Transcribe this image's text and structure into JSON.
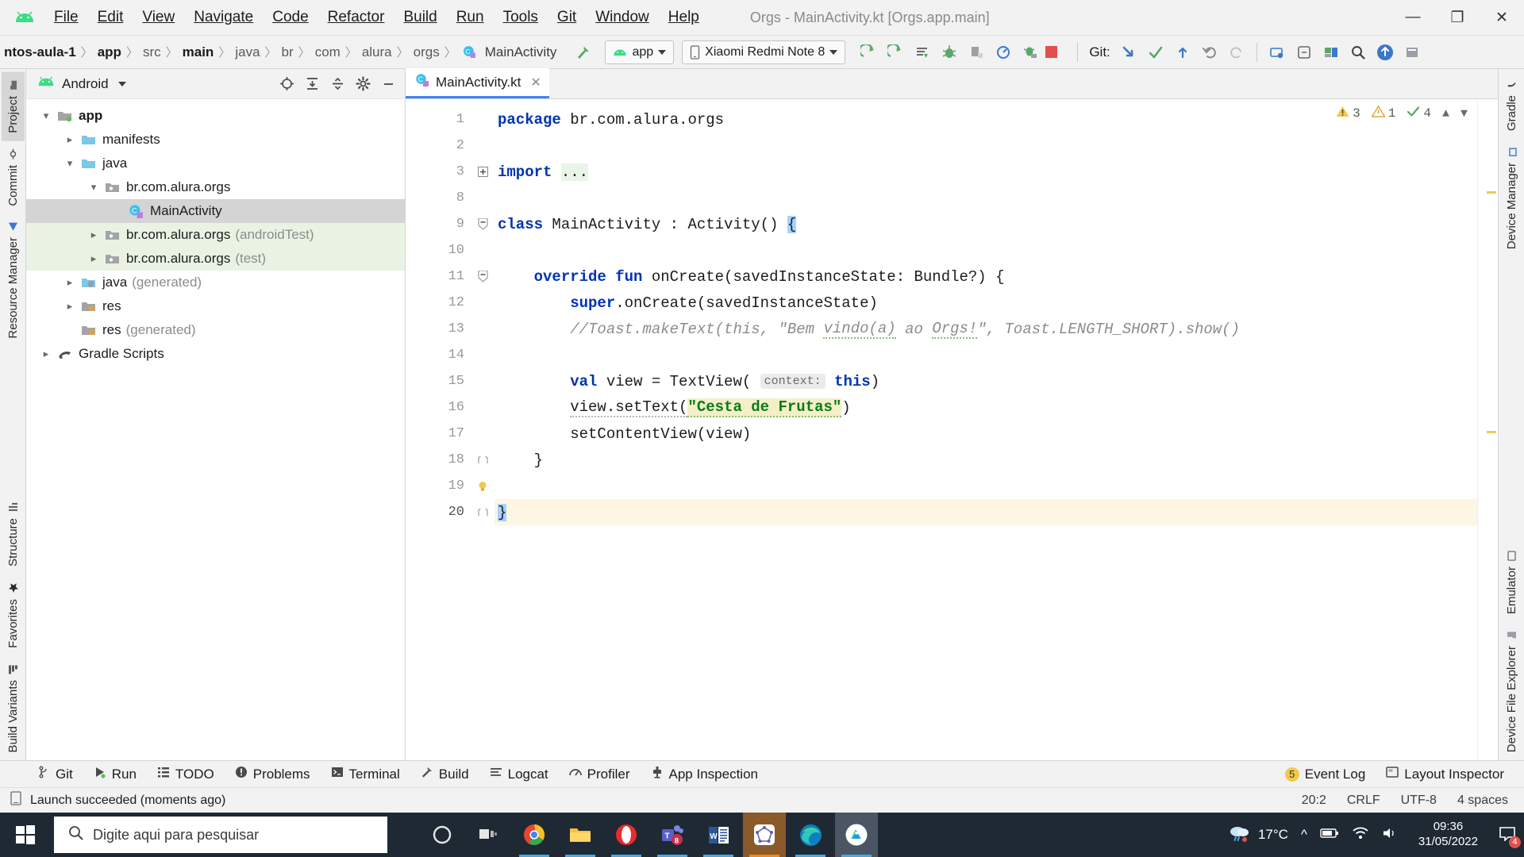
{
  "window": {
    "title": "Orgs - MainActivity.kt [Orgs.app.main]",
    "minimize": "—",
    "maximize": "❐",
    "close": "✕"
  },
  "menu": {
    "items": [
      "File",
      "Edit",
      "View",
      "Navigate",
      "Code",
      "Refactor",
      "Build",
      "Run",
      "Tools",
      "Git",
      "Window",
      "Help"
    ]
  },
  "toolbar": {
    "breadcrumbs": [
      "ntos-aula-1",
      "app",
      "src",
      "main",
      "java",
      "br",
      "com",
      "alura",
      "orgs",
      "MainActivity"
    ],
    "separator": "〉",
    "run_config": "app",
    "device": "Xiaomi Redmi Note 8",
    "git_label": "Git:",
    "icons": [
      "run-icon",
      "debug-icon",
      "run-with-coverage-icon",
      "profile-icon",
      "attach-debugger-icon",
      "stop-icon"
    ]
  },
  "left_rail": {
    "tabs": [
      "Project",
      "Commit",
      "Resource Manager"
    ],
    "bottom_tabs": [
      "Structure",
      "Favorites",
      "Build Variants"
    ],
    "active": "Project"
  },
  "right_rail": {
    "tabs": [
      "Gradle",
      "Device Manager",
      "Emulator",
      "Device File Explorer"
    ]
  },
  "project_panel": {
    "view_name": "Android",
    "actions": [
      "locate-icon",
      "expand-all-icon",
      "collapse-all-icon",
      "settings-icon",
      "hide-icon"
    ],
    "tree": [
      {
        "label": "app",
        "suffix": "",
        "depth": 0,
        "arrow": "down",
        "icon": "module-folder-icon",
        "bold": true,
        "state": "normal"
      },
      {
        "label": "manifests",
        "suffix": "",
        "depth": 1,
        "arrow": "right",
        "icon": "folder-blue-icon",
        "bold": false,
        "state": "normal"
      },
      {
        "label": "java",
        "suffix": "",
        "depth": 1,
        "arrow": "down",
        "icon": "folder-blue-icon",
        "bold": false,
        "state": "normal"
      },
      {
        "label": "br.com.alura.orgs",
        "suffix": "",
        "depth": 2,
        "arrow": "down",
        "icon": "package-icon",
        "bold": false,
        "state": "normal"
      },
      {
        "label": "MainActivity",
        "suffix": "",
        "depth": 3,
        "arrow": "none",
        "icon": "kotlin-class-icon",
        "bold": false,
        "state": "selected"
      },
      {
        "label": "br.com.alura.orgs",
        "suffix": "(androidTest)",
        "depth": 2,
        "arrow": "right",
        "icon": "package-icon",
        "bold": false,
        "state": "test"
      },
      {
        "label": "br.com.alura.orgs",
        "suffix": "(test)",
        "depth": 2,
        "arrow": "right",
        "icon": "package-icon",
        "bold": false,
        "state": "test"
      },
      {
        "label": "java",
        "suffix": "(generated)",
        "depth": 1,
        "arrow": "right",
        "icon": "folder-generated-icon",
        "bold": false,
        "state": "normal"
      },
      {
        "label": "res",
        "suffix": "",
        "depth": 1,
        "arrow": "right",
        "icon": "folder-res-icon",
        "bold": false,
        "state": "normal"
      },
      {
        "label": "res",
        "suffix": "(generated)",
        "depth": 1,
        "arrow": "none",
        "icon": "folder-res-icon",
        "bold": false,
        "state": "normal"
      },
      {
        "label": "Gradle Scripts",
        "suffix": "",
        "depth": 0,
        "arrow": "right",
        "icon": "gradle-icon",
        "bold": false,
        "state": "normal"
      }
    ]
  },
  "editor": {
    "tab": {
      "name": "MainActivity.kt",
      "close": "✕"
    },
    "inspections": {
      "warnings": "3",
      "weak_warnings": "1",
      "checks": "4"
    },
    "line_numbers": [
      "1",
      "2",
      "3",
      "8",
      "9",
      "10",
      "11",
      "12",
      "13",
      "14",
      "15",
      "16",
      "17",
      "18",
      "19",
      "20"
    ],
    "lines": [
      {
        "n": "1",
        "segments": [
          {
            "t": "package ",
            "c": "kw"
          },
          {
            "t": "br.com.alura.orgs",
            "c": ""
          }
        ]
      },
      {
        "n": "2",
        "segments": []
      },
      {
        "n": "3",
        "segments": [
          {
            "t": "import ",
            "c": "kw"
          },
          {
            "t": "...",
            "c": "fold"
          }
        ]
      },
      {
        "n": "8",
        "segments": []
      },
      {
        "n": "9",
        "segments": [
          {
            "t": "class ",
            "c": "kw"
          },
          {
            "t": "MainActivity : Activity() ",
            "c": ""
          },
          {
            "t": "{",
            "c": "selbrace"
          }
        ]
      },
      {
        "n": "10",
        "segments": []
      },
      {
        "n": "11",
        "segments": [
          {
            "t": "    ",
            "c": ""
          },
          {
            "t": "override fun ",
            "c": "kw"
          },
          {
            "t": "onCreate(savedInstanceState: Bundle?) {",
            "c": ""
          }
        ]
      },
      {
        "n": "12",
        "segments": [
          {
            "t": "        ",
            "c": ""
          },
          {
            "t": "super",
            "c": "kw"
          },
          {
            "t": ".onCreate(savedInstanceState)",
            "c": ""
          }
        ]
      },
      {
        "n": "13",
        "segments": [
          {
            "t": "        ",
            "c": ""
          },
          {
            "t": "//Toast.makeText(this, \"Bem vindo(a) ao Orgs!\", Toast.LENGTH_SHORT).show()",
            "c": "cmt"
          }
        ]
      },
      {
        "n": "14",
        "segments": []
      },
      {
        "n": "15",
        "segments": [
          {
            "t": "        ",
            "c": ""
          },
          {
            "t": "val ",
            "c": "kw"
          },
          {
            "t": "view = TextView( ",
            "c": ""
          },
          {
            "t": "context:",
            "c": "hint"
          },
          {
            "t": " ",
            "c": ""
          },
          {
            "t": "this",
            "c": "kw"
          },
          {
            "t": ")",
            "c": ""
          }
        ]
      },
      {
        "n": "16",
        "segments": [
          {
            "t": "        ",
            "c": ""
          },
          {
            "t": "view.setText(",
            "c": ""
          },
          {
            "t": "\"Cesta de Frutas\"",
            "c": "strhl"
          },
          {
            "t": ")",
            "c": ""
          }
        ]
      },
      {
        "n": "17",
        "segments": [
          {
            "t": "        ",
            "c": ""
          },
          {
            "t": "setContentView(view)",
            "c": ""
          }
        ]
      },
      {
        "n": "18",
        "segments": [
          {
            "t": "    }",
            "c": ""
          }
        ]
      },
      {
        "n": "19",
        "segments": []
      },
      {
        "n": "20",
        "segments": [
          {
            "t": "}",
            "c": "cursor"
          }
        ],
        "highlight": true
      }
    ]
  },
  "tool_windows": {
    "left": [
      {
        "label": "Git",
        "icon": "git-branch-icon"
      },
      {
        "label": "Run",
        "icon": "run-green-icon"
      },
      {
        "label": "TODO",
        "icon": "todo-list-icon"
      },
      {
        "label": "Problems",
        "icon": "problems-icon"
      },
      {
        "label": "Terminal",
        "icon": "terminal-icon"
      },
      {
        "label": "Build",
        "icon": "build-hammer-icon"
      },
      {
        "label": "Logcat",
        "icon": "logcat-icon"
      },
      {
        "label": "Profiler",
        "icon": "profiler-icon"
      },
      {
        "label": "App Inspection",
        "icon": "app-inspection-icon"
      }
    ],
    "right": [
      {
        "label": "Event Log",
        "icon": "event-log-icon",
        "badge": "5"
      },
      {
        "label": "Layout Inspector",
        "icon": "layout-inspector-icon",
        "badge": ""
      }
    ]
  },
  "status_bar": {
    "message": "Launch succeeded (moments ago)",
    "caret": "20:2",
    "line_ending": "CRLF",
    "encoding": "UTF-8",
    "indent": "4 spaces"
  },
  "taskbar": {
    "search_placeholder": "Digite aqui para pesquisar",
    "apps": [
      {
        "name": "cortana-icon",
        "state": "plain"
      },
      {
        "name": "task-view-icon",
        "state": "plain"
      },
      {
        "name": "chrome-icon",
        "state": "running"
      },
      {
        "name": "file-explorer-icon",
        "state": "running"
      },
      {
        "name": "opera-icon",
        "state": "running"
      },
      {
        "name": "microsoft-teams-icon",
        "state": "running",
        "badge": "8"
      },
      {
        "name": "microsoft-word-icon",
        "state": "running"
      },
      {
        "name": "geogebra-icon",
        "state": "active-orange"
      },
      {
        "name": "microsoft-edge-icon",
        "state": "running"
      },
      {
        "name": "android-studio-icon",
        "state": "active-grey"
      }
    ],
    "weather": {
      "icon": "rain-cloud-icon",
      "temp": "17°C"
    },
    "tray": [
      "chevron-up-icon",
      "battery-icon",
      "wifi-icon",
      "speaker-icon"
    ],
    "clock": {
      "time": "09:36",
      "date": "31/05/2022"
    },
    "notifications": {
      "icon": "notification-icon",
      "count": "4"
    }
  },
  "colors": {
    "accent_blue": "#4285f4",
    "android_green": "#3ddc84",
    "taskbar_bg": "#1f2933",
    "selection": "#d4d4d4",
    "test_bg": "#eaf3e3",
    "string_green": "#067d17",
    "keyword_blue": "#0033b3"
  }
}
